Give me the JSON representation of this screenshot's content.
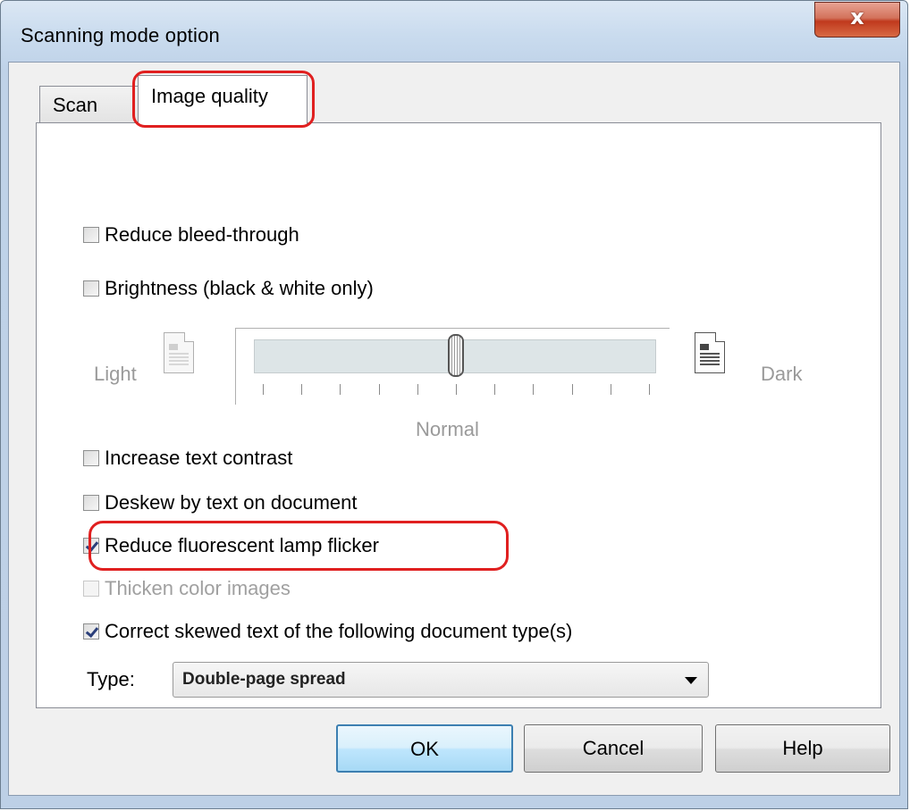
{
  "window": {
    "title": "Scanning mode option",
    "close_label": "x"
  },
  "tabs": [
    {
      "label": "Scan",
      "active": false
    },
    {
      "label": "Image quality",
      "active": true
    }
  ],
  "options": {
    "reduce_bleed_through": {
      "label": "Reduce bleed-through",
      "checked": false,
      "enabled": true
    },
    "brightness": {
      "label": "Brightness (black & white only)",
      "checked": false,
      "enabled": true
    },
    "increase_text_contrast": {
      "label": "Increase text contrast",
      "checked": false,
      "enabled": true
    },
    "deskew_by_text": {
      "label": "Deskew by text on document",
      "checked": false,
      "enabled": true
    },
    "reduce_flicker": {
      "label": "Reduce fluorescent lamp flicker",
      "checked": true,
      "enabled": true
    },
    "thicken_color": {
      "label": "Thicken color images",
      "checked": false,
      "enabled": false
    },
    "correct_skewed": {
      "label": "Correct skewed text of the following document type(s)",
      "checked": true,
      "enabled": true
    }
  },
  "brightness_slider": {
    "min_label": "Light",
    "max_label": "Dark",
    "center_label": "Normal",
    "tick_count": 11,
    "value_fraction": 0.5,
    "enabled": false
  },
  "type_select": {
    "label": "Type:",
    "value": "Double-page spread"
  },
  "buttons": {
    "ok": "OK",
    "cancel": "Cancel",
    "help": "Help"
  },
  "colors": {
    "highlight": "#e02020",
    "checkmark": "#2b3f7a"
  }
}
